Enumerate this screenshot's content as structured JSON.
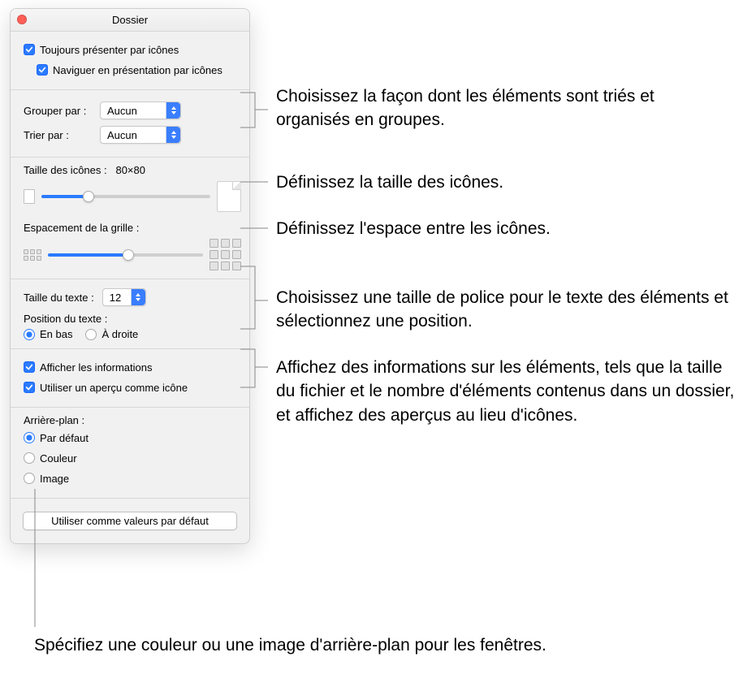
{
  "window_title": "Dossier",
  "checks": {
    "always_icons": "Toujours présenter par icônes",
    "browse_icons": "Naviguer en présentation par icônes",
    "show_info": "Afficher les informations",
    "use_preview": "Utiliser un aperçu comme icône"
  },
  "group": {
    "group_label": "Grouper par :",
    "group_value": "Aucun",
    "sort_label": "Trier par :",
    "sort_value": "Aucun"
  },
  "icon_size": {
    "label": "Taille des icônes :",
    "value": "80×80",
    "slider_pct": 28
  },
  "grid_spacing": {
    "label": "Espacement de la grille :",
    "slider_pct": 52
  },
  "text_size": {
    "label": "Taille du texte :",
    "value": "12"
  },
  "text_pos": {
    "label": "Position du texte :",
    "bottom": "En bas",
    "right": "À droite"
  },
  "background": {
    "label": "Arrière-plan :",
    "default": "Par défaut",
    "color": "Couleur",
    "image": "Image"
  },
  "default_button": "Utiliser comme valeurs par défaut",
  "callouts": {
    "c1": "Choisissez la façon dont les éléments sont triés et organisés en groupes.",
    "c2": "Définissez la taille des icônes.",
    "c3": "Définissez l'espace entre les icônes.",
    "c4": "Choisissez une taille de police pour le texte des éléments et sélectionnez une position.",
    "c5": "Affichez des informations sur les éléments, tels que la taille du fichier et le nombre d'éléments contenus dans un dossier, et affichez des aperçus au lieu d'icônes.",
    "c6": "Spécifiez une couleur ou une image d'arrière-plan pour les fenêtres."
  }
}
